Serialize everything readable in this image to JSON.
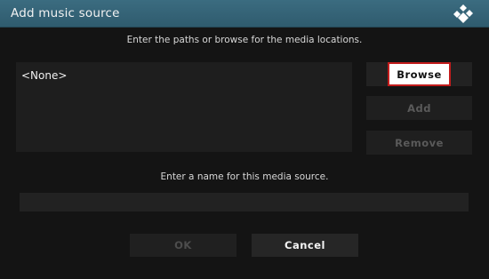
{
  "window": {
    "title": "Add music source",
    "logo_icon": "kodi-logo-icon"
  },
  "instructions": {
    "paths": "Enter the paths or browse for the media locations.",
    "name": "Enter a name for this media source."
  },
  "sources": {
    "items": [
      "<None>"
    ]
  },
  "buttons": {
    "browse": "Browse",
    "add": "Add",
    "remove": "Remove",
    "ok": "OK",
    "cancel": "Cancel"
  },
  "name_field": {
    "value": ""
  },
  "colors": {
    "titlebar": "#3b6c80",
    "focus_border": "#c21c1c",
    "background": "#141414"
  }
}
